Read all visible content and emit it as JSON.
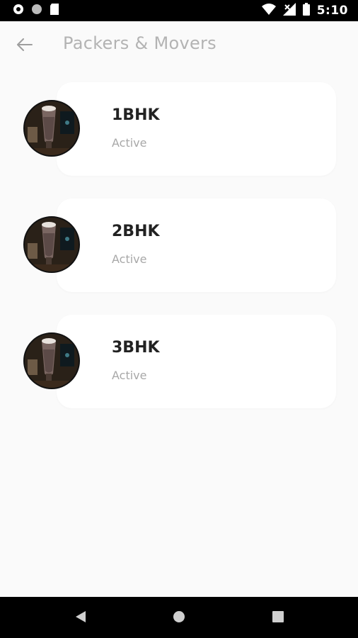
{
  "status_bar": {
    "time": "5:10",
    "icons": [
      "notification-icon",
      "circle-icon",
      "sd-card-icon",
      "wifi-icon",
      "no-signal-icon",
      "battery-icon"
    ]
  },
  "app_bar": {
    "title": "Packers & Movers",
    "back_icon": "arrow-back-icon"
  },
  "items": [
    {
      "title": "1BHK",
      "status": "Active",
      "avatar_icon": "milkshake-image"
    },
    {
      "title": "2BHK",
      "status": "Active",
      "avatar_icon": "milkshake-image"
    },
    {
      "title": "3BHK",
      "status": "Active",
      "avatar_icon": "milkshake-image"
    }
  ],
  "nav_bar": {
    "back": "nav-back-icon",
    "home": "nav-home-icon",
    "recents": "nav-recents-icon"
  },
  "colors": {
    "background": "#fafafa",
    "card": "#ffffff",
    "title_text": "#222222",
    "muted_text": "#a8a8a8",
    "app_title": "#b3b3b3"
  }
}
